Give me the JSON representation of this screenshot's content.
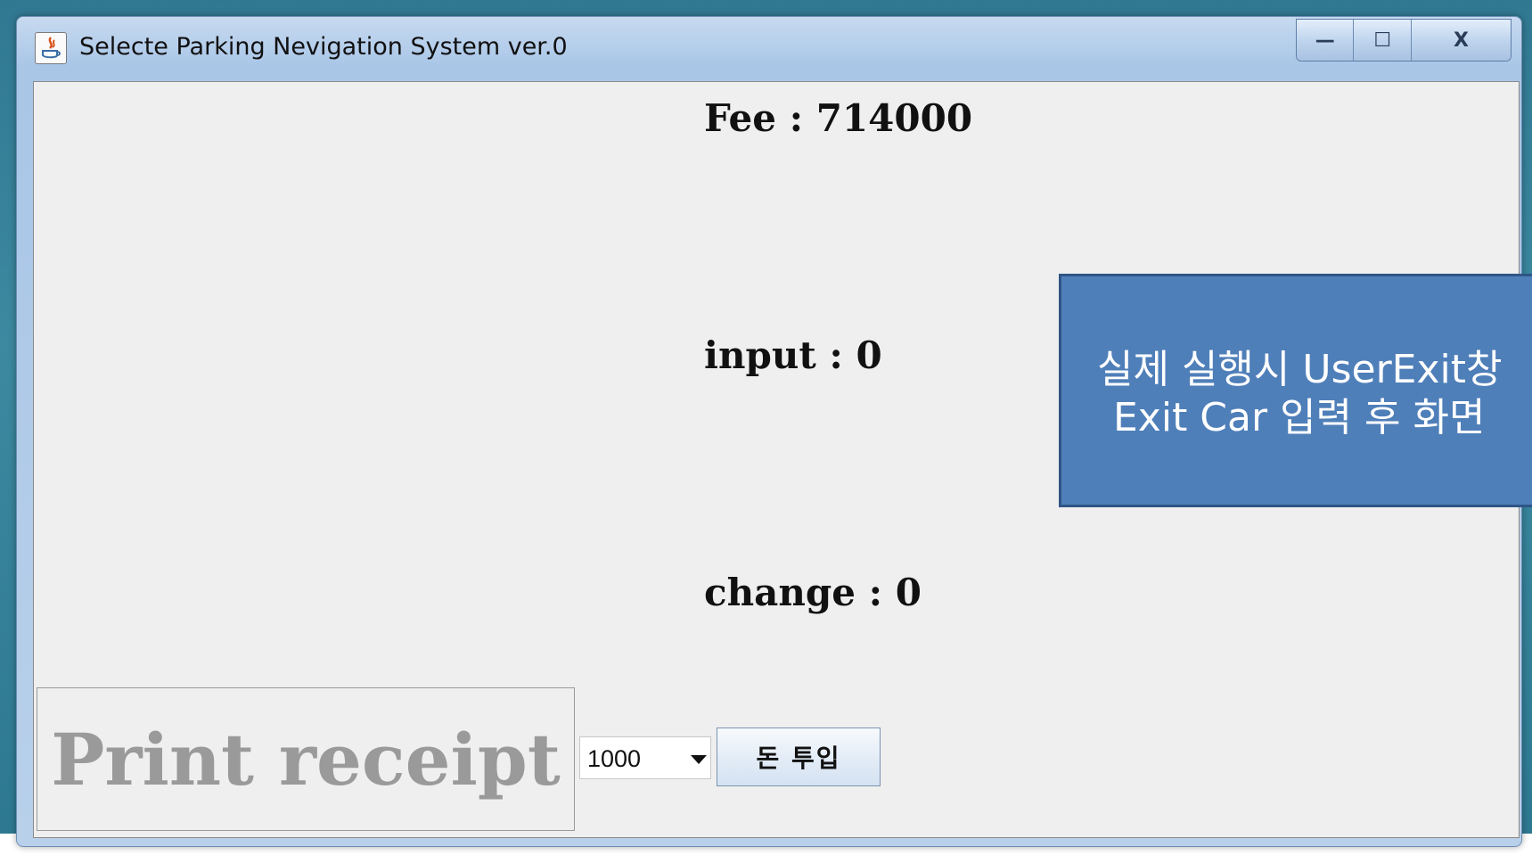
{
  "window": {
    "title": "Selecte Parking Nevigation System ver.0",
    "controls": {
      "minimize": "—",
      "maximize": "☐",
      "close": "X"
    }
  },
  "payment": {
    "fee": "Fee : 714000",
    "input": "input : 0",
    "change": "change : 0"
  },
  "actions": {
    "receipt_label": "Print receipt",
    "coin_amount_selected": "1000",
    "coin_button_label": "돈 투입"
  },
  "annotation": {
    "line1": "실제 실행시 UserExit창",
    "line2": "Exit Car 입력 후 화면"
  },
  "colors": {
    "note_bg": "#4f7fb9",
    "client_bg": "#efefef",
    "receipt_text": "#9a9a9a"
  }
}
